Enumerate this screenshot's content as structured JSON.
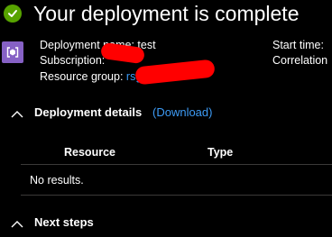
{
  "header": {
    "title": "Your deployment is complete",
    "status_icon": "check-circle-icon",
    "success_color": "#57a300"
  },
  "details": {
    "deployment_name_label": "Deployment name:",
    "deployment_name_value": "test",
    "subscription_label": "Subscription:",
    "resource_group_label": "Resource group:",
    "resource_group_value": "rsg",
    "start_time_label": "Start time:",
    "correlation_label": "Correlation"
  },
  "deployment_details": {
    "title": "Deployment details",
    "download_label": "(Download)",
    "columns": [
      "Resource",
      "Type"
    ],
    "empty_message": "No results."
  },
  "next_steps": {
    "title": "Next steps"
  },
  "colors": {
    "background": "#000000",
    "link": "#3d9bf5",
    "redaction": "#ff0000",
    "deploy_icon": "#8661c5"
  }
}
